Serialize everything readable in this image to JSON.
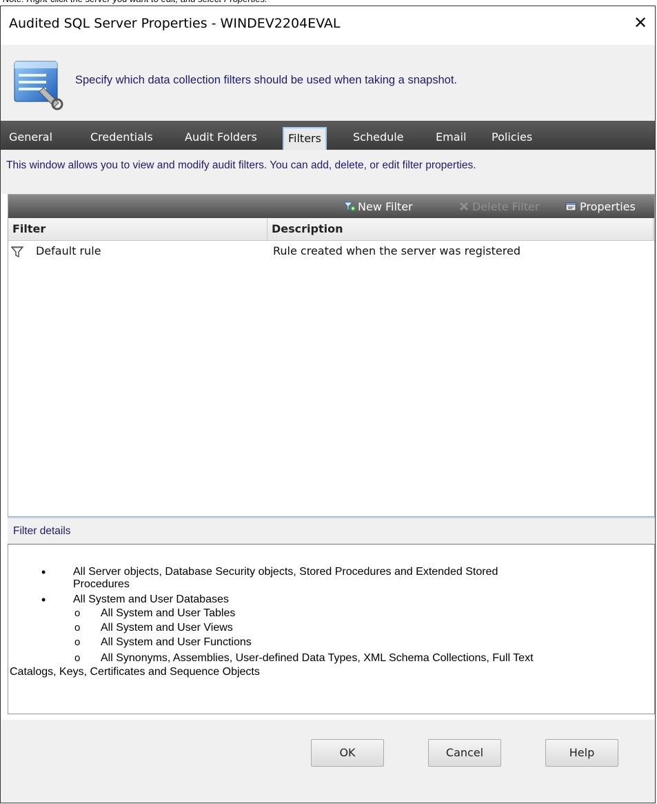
{
  "top_note": "Note: Right-click the server you want to edit, and select Properties.",
  "window": {
    "title": "Audited SQL Server Properties - WINDEV2204EVAL",
    "close_glyph": "✕"
  },
  "header": {
    "text": "Specify which data collection filters should be used when taking a snapshot."
  },
  "tabs": [
    {
      "label": "General"
    },
    {
      "label": "Credentials"
    },
    {
      "label": "Audit Folders"
    },
    {
      "label": "Filters"
    },
    {
      "label": "Schedule"
    },
    {
      "label": "Email"
    },
    {
      "label": "Policies"
    }
  ],
  "active_tab": "Filters",
  "info": {
    "text": "This window allows you to view and modify audit filters.  You can add, delete, or edit filter properties."
  },
  "toolbar": {
    "new_filter": "New Filter",
    "delete_filter": "Delete Filter",
    "properties": "Properties"
  },
  "grid": {
    "columns": [
      "Filter",
      "Description"
    ],
    "rows": [
      {
        "filter": "Default rule",
        "description": "Rule created when the server was registered"
      }
    ]
  },
  "details": {
    "heading": "Filter details",
    "b1a": "All Server objects, Database Security objects, Stored Procedures and Extended Stored",
    "b1b": "Procedures",
    "b2": "All System and User Databases",
    "s1": "All System and User Tables",
    "s2": "All System and User Views",
    "s3": "All System and User Functions",
    "s4a": "All Synonyms, Assemblies, User-defined Data Types, XML Schema Collections, Full Text",
    "s4b": "Catalogs, Keys, Certificates and Sequence Objects",
    "bullet_glyph": "•",
    "sub_glyph": "o"
  },
  "buttons": {
    "ok": "OK",
    "cancel": "Cancel",
    "help": "Help"
  },
  "colors": {
    "accent_text": "#1e1a6e",
    "tabbar": "#4a4a4a",
    "active_tab_border": "#9fc8ee"
  }
}
